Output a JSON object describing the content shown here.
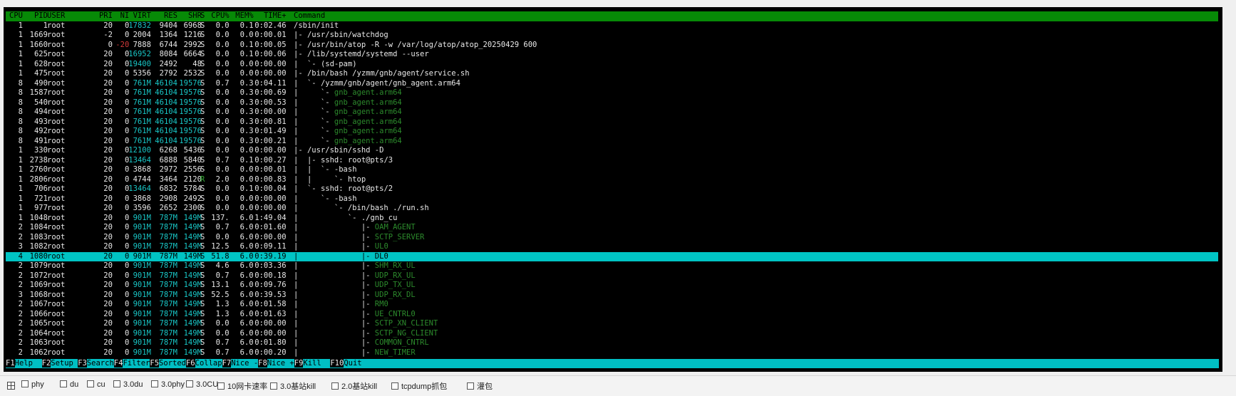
{
  "app": {
    "name": "htop"
  },
  "header": [
    "CPU",
    "PID",
    "USER",
    "PRI",
    "NI",
    "VIRT",
    "RES",
    "SHR",
    "S",
    "CPU%",
    "MEM%",
    "TIME+",
    "Command"
  ],
  "processes": [
    {
      "cpu": "1",
      "pid": "1",
      "user": "root",
      "pri": "20",
      "ni": "0",
      "virt": "17832",
      "res": "9404",
      "shr": "6968",
      "s": "S",
      "cpupct": "0.0",
      "mempct": "0.1",
      "time": "0:02.46",
      "tree": "",
      "cmd": "/sbin/init",
      "cmd_dim": false,
      "selected": false
    },
    {
      "cpu": "1",
      "pid": "1669",
      "user": "root",
      "pri": "-2",
      "ni": "0",
      "virt": "2004",
      "res": "1364",
      "shr": "1216",
      "s": "S",
      "cpupct": "0.0",
      "mempct": "0.0",
      "time": "0:00.01",
      "tree": "|- ",
      "cmd": "/usr/sbin/watchdog",
      "cmd_dim": false,
      "selected": false
    },
    {
      "cpu": "1",
      "pid": "1660",
      "user": "root",
      "pri": "0",
      "ni": "-20",
      "virt": "7888",
      "res": "6744",
      "shr": "2992",
      "s": "S",
      "cpupct": "0.0",
      "mempct": "0.1",
      "time": "0:00.05",
      "tree": "|- ",
      "cmd": "/usr/bin/atop -R -w /var/log/atop/atop_20250429 600",
      "cmd_dim": false,
      "selected": false
    },
    {
      "cpu": "1",
      "pid": "625",
      "user": "root",
      "pri": "20",
      "ni": "0",
      "virt": "16952",
      "res": "8084",
      "shr": "6664",
      "s": "S",
      "cpupct": "0.0",
      "mempct": "0.1",
      "time": "0:00.06",
      "tree": "|- ",
      "cmd": "/lib/systemd/systemd --user",
      "cmd_dim": false,
      "selected": false
    },
    {
      "cpu": "1",
      "pid": "628",
      "user": "root",
      "pri": "20",
      "ni": "0",
      "virt": "19400",
      "res": "2492",
      "shr": "48",
      "s": "S",
      "cpupct": "0.0",
      "mempct": "0.0",
      "time": "0:00.00",
      "tree": "|  `- ",
      "cmd": "(sd-pam)",
      "cmd_dim": false,
      "selected": false
    },
    {
      "cpu": "1",
      "pid": "475",
      "user": "root",
      "pri": "20",
      "ni": "0",
      "virt": "5356",
      "res": "2792",
      "shr": "2532",
      "s": "S",
      "cpupct": "0.0",
      "mempct": "0.0",
      "time": "0:00.00",
      "tree": "|- ",
      "cmd": "/bin/bash /yzmm/gnb/agent/service.sh",
      "cmd_dim": false,
      "selected": false
    },
    {
      "cpu": "8",
      "pid": "490",
      "user": "root",
      "pri": "20",
      "ni": "0",
      "virt": "761M",
      "res": "46104",
      "shr": "19576",
      "s": "S",
      "cpupct": "0.7",
      "mempct": "0.3",
      "time": "0:04.11",
      "tree": "|  `- ",
      "cmd": "/yzmm/gnb/agent/gnb_agent.arm64",
      "cmd_dim": false,
      "selected": false
    },
    {
      "cpu": "8",
      "pid": "1587",
      "user": "root",
      "pri": "20",
      "ni": "0",
      "virt": "761M",
      "res": "46104",
      "shr": "19576",
      "s": "S",
      "cpupct": "0.0",
      "mempct": "0.3",
      "time": "0:00.69",
      "tree": "|     `- ",
      "cmd": "gnb_agent.arm64",
      "cmd_dim": true,
      "selected": false
    },
    {
      "cpu": "8",
      "pid": "540",
      "user": "root",
      "pri": "20",
      "ni": "0",
      "virt": "761M",
      "res": "46104",
      "shr": "19576",
      "s": "S",
      "cpupct": "0.0",
      "mempct": "0.3",
      "time": "0:00.53",
      "tree": "|     `- ",
      "cmd": "gnb_agent.arm64",
      "cmd_dim": true,
      "selected": false
    },
    {
      "cpu": "8",
      "pid": "494",
      "user": "root",
      "pri": "20",
      "ni": "0",
      "virt": "761M",
      "res": "46104",
      "shr": "19576",
      "s": "S",
      "cpupct": "0.0",
      "mempct": "0.3",
      "time": "0:00.00",
      "tree": "|     `- ",
      "cmd": "gnb_agent.arm64",
      "cmd_dim": true,
      "selected": false
    },
    {
      "cpu": "8",
      "pid": "493",
      "user": "root",
      "pri": "20",
      "ni": "0",
      "virt": "761M",
      "res": "46104",
      "shr": "19576",
      "s": "S",
      "cpupct": "0.0",
      "mempct": "0.3",
      "time": "0:00.81",
      "tree": "|     `- ",
      "cmd": "gnb_agent.arm64",
      "cmd_dim": true,
      "selected": false
    },
    {
      "cpu": "8",
      "pid": "492",
      "user": "root",
      "pri": "20",
      "ni": "0",
      "virt": "761M",
      "res": "46104",
      "shr": "19576",
      "s": "S",
      "cpupct": "0.0",
      "mempct": "0.3",
      "time": "0:01.49",
      "tree": "|     `- ",
      "cmd": "gnb_agent.arm64",
      "cmd_dim": true,
      "selected": false
    },
    {
      "cpu": "8",
      "pid": "491",
      "user": "root",
      "pri": "20",
      "ni": "0",
      "virt": "761M",
      "res": "46104",
      "shr": "19576",
      "s": "S",
      "cpupct": "0.0",
      "mempct": "0.3",
      "time": "0:00.21",
      "tree": "|     `- ",
      "cmd": "gnb_agent.arm64",
      "cmd_dim": true,
      "selected": false
    },
    {
      "cpu": "1",
      "pid": "330",
      "user": "root",
      "pri": "20",
      "ni": "0",
      "virt": "12100",
      "res": "6268",
      "shr": "5436",
      "s": "S",
      "cpupct": "0.0",
      "mempct": "0.0",
      "time": "0:00.00",
      "tree": "|- ",
      "cmd": "/usr/sbin/sshd -D",
      "cmd_dim": false,
      "selected": false
    },
    {
      "cpu": "1",
      "pid": "2738",
      "user": "root",
      "pri": "20",
      "ni": "0",
      "virt": "13464",
      "res": "6888",
      "shr": "5840",
      "s": "S",
      "cpupct": "0.7",
      "mempct": "0.1",
      "time": "0:00.27",
      "tree": "|  |- ",
      "cmd": "sshd: root@pts/3",
      "cmd_dim": false,
      "selected": false
    },
    {
      "cpu": "1",
      "pid": "2760",
      "user": "root",
      "pri": "20",
      "ni": "0",
      "virt": "3868",
      "res": "2972",
      "shr": "2556",
      "s": "S",
      "cpupct": "0.0",
      "mempct": "0.0",
      "time": "0:00.01",
      "tree": "|  |  `- ",
      "cmd": "-bash",
      "cmd_dim": false,
      "selected": false
    },
    {
      "cpu": "1",
      "pid": "2806",
      "user": "root",
      "pri": "20",
      "ni": "0",
      "virt": "4744",
      "res": "3464",
      "shr": "2120",
      "s": "R",
      "cpupct": "2.0",
      "mempct": "0.0",
      "time": "0:00.83",
      "tree": "|  |     `- ",
      "cmd": "htop",
      "cmd_dim": false,
      "selected": false
    },
    {
      "cpu": "1",
      "pid": "706",
      "user": "root",
      "pri": "20",
      "ni": "0",
      "virt": "13464",
      "res": "6832",
      "shr": "5784",
      "s": "S",
      "cpupct": "0.0",
      "mempct": "0.1",
      "time": "0:00.04",
      "tree": "|  `- ",
      "cmd": "sshd: root@pts/2",
      "cmd_dim": false,
      "selected": false
    },
    {
      "cpu": "1",
      "pid": "721",
      "user": "root",
      "pri": "20",
      "ni": "0",
      "virt": "3868",
      "res": "2908",
      "shr": "2492",
      "s": "S",
      "cpupct": "0.0",
      "mempct": "0.0",
      "time": "0:00.00",
      "tree": "|     `- ",
      "cmd": "-bash",
      "cmd_dim": false,
      "selected": false
    },
    {
      "cpu": "1",
      "pid": "977",
      "user": "root",
      "pri": "20",
      "ni": "0",
      "virt": "3596",
      "res": "2652",
      "shr": "2300",
      "s": "S",
      "cpupct": "0.0",
      "mempct": "0.0",
      "time": "0:00.00",
      "tree": "|        `- ",
      "cmd": "/bin/bash ./run.sh",
      "cmd_dim": false,
      "selected": false
    },
    {
      "cpu": "1",
      "pid": "1048",
      "user": "root",
      "pri": "20",
      "ni": "0",
      "virt": "901M",
      "res": "787M",
      "shr": "149M",
      "s": "S",
      "cpupct": "137.",
      "mempct": "6.0",
      "time": "1:49.04",
      "tree": "|           `- ",
      "cmd": "./gnb_cu",
      "cmd_dim": false,
      "selected": false
    },
    {
      "cpu": "2",
      "pid": "1084",
      "user": "root",
      "pri": "20",
      "ni": "0",
      "virt": "901M",
      "res": "787M",
      "shr": "149M",
      "s": "S",
      "cpupct": "0.7",
      "mempct": "6.0",
      "time": "0:01.60",
      "tree": "|              |- ",
      "cmd": "OAM_AGENT",
      "cmd_dim": true,
      "selected": false
    },
    {
      "cpu": "2",
      "pid": "1083",
      "user": "root",
      "pri": "20",
      "ni": "0",
      "virt": "901M",
      "res": "787M",
      "shr": "149M",
      "s": "S",
      "cpupct": "0.0",
      "mempct": "6.0",
      "time": "0:00.00",
      "tree": "|              |- ",
      "cmd": "SCTP_SERVER",
      "cmd_dim": true,
      "selected": false
    },
    {
      "cpu": "3",
      "pid": "1082",
      "user": "root",
      "pri": "20",
      "ni": "0",
      "virt": "901M",
      "res": "787M",
      "shr": "149M",
      "s": "S",
      "cpupct": "12.5",
      "mempct": "6.0",
      "time": "0:09.11",
      "tree": "|              |- ",
      "cmd": "UL0",
      "cmd_dim": true,
      "selected": false
    },
    {
      "cpu": "4",
      "pid": "1080",
      "user": "root",
      "pri": "20",
      "ni": "0",
      "virt": "901M",
      "res": "787M",
      "shr": "149M",
      "s": "S",
      "cpupct": "51.8",
      "mempct": "6.0",
      "time": "0:39.19",
      "tree": "|              |- ",
      "cmd": "DL0",
      "cmd_dim": false,
      "selected": true
    },
    {
      "cpu": "2",
      "pid": "1079",
      "user": "root",
      "pri": "20",
      "ni": "0",
      "virt": "901M",
      "res": "787M",
      "shr": "149M",
      "s": "S",
      "cpupct": "4.6",
      "mempct": "6.0",
      "time": "0:03.36",
      "tree": "|              |- ",
      "cmd": "SHM_RX_UL",
      "cmd_dim": true,
      "selected": false
    },
    {
      "cpu": "2",
      "pid": "1072",
      "user": "root",
      "pri": "20",
      "ni": "0",
      "virt": "901M",
      "res": "787M",
      "shr": "149M",
      "s": "S",
      "cpupct": "0.7",
      "mempct": "6.0",
      "time": "0:00.18",
      "tree": "|              |- ",
      "cmd": "UDP_RX_UL",
      "cmd_dim": true,
      "selected": false
    },
    {
      "cpu": "2",
      "pid": "1069",
      "user": "root",
      "pri": "20",
      "ni": "0",
      "virt": "901M",
      "res": "787M",
      "shr": "149M",
      "s": "S",
      "cpupct": "13.1",
      "mempct": "6.0",
      "time": "0:09.76",
      "tree": "|              |- ",
      "cmd": "UDP_TX_UL",
      "cmd_dim": true,
      "selected": false
    },
    {
      "cpu": "3",
      "pid": "1068",
      "user": "root",
      "pri": "20",
      "ni": "0",
      "virt": "901M",
      "res": "787M",
      "shr": "149M",
      "s": "S",
      "cpupct": "52.5",
      "mempct": "6.0",
      "time": "0:39.53",
      "tree": "|              |- ",
      "cmd": "UDP_RX_DL",
      "cmd_dim": true,
      "selected": false
    },
    {
      "cpu": "2",
      "pid": "1067",
      "user": "root",
      "pri": "20",
      "ni": "0",
      "virt": "901M",
      "res": "787M",
      "shr": "149M",
      "s": "S",
      "cpupct": "1.3",
      "mempct": "6.0",
      "time": "0:01.58",
      "tree": "|              |- ",
      "cmd": "RM0",
      "cmd_dim": true,
      "selected": false
    },
    {
      "cpu": "2",
      "pid": "1066",
      "user": "root",
      "pri": "20",
      "ni": "0",
      "virt": "901M",
      "res": "787M",
      "shr": "149M",
      "s": "S",
      "cpupct": "1.3",
      "mempct": "6.0",
      "time": "0:01.63",
      "tree": "|              |- ",
      "cmd": "UE_CNTRL0",
      "cmd_dim": true,
      "selected": false
    },
    {
      "cpu": "2",
      "pid": "1065",
      "user": "root",
      "pri": "20",
      "ni": "0",
      "virt": "901M",
      "res": "787M",
      "shr": "149M",
      "s": "S",
      "cpupct": "0.0",
      "mempct": "6.0",
      "time": "0:00.00",
      "tree": "|              |- ",
      "cmd": "SCTP_XN_CLIENT",
      "cmd_dim": true,
      "selected": false
    },
    {
      "cpu": "2",
      "pid": "1064",
      "user": "root",
      "pri": "20",
      "ni": "0",
      "virt": "901M",
      "res": "787M",
      "shr": "149M",
      "s": "S",
      "cpupct": "0.0",
      "mempct": "6.0",
      "time": "0:00.00",
      "tree": "|              |- ",
      "cmd": "SCTP_NG_CLIENT",
      "cmd_dim": true,
      "selected": false
    },
    {
      "cpu": "2",
      "pid": "1063",
      "user": "root",
      "pri": "20",
      "ni": "0",
      "virt": "901M",
      "res": "787M",
      "shr": "149M",
      "s": "S",
      "cpupct": "0.7",
      "mempct": "6.0",
      "time": "0:01.80",
      "tree": "|              |- ",
      "cmd": "COMMON_CNTRL",
      "cmd_dim": true,
      "selected": false
    },
    {
      "cpu": "2",
      "pid": "1062",
      "user": "root",
      "pri": "20",
      "ni": "0",
      "virt": "901M",
      "res": "787M",
      "shr": "149M",
      "s": "S",
      "cpupct": "0.7",
      "mempct": "6.0",
      "time": "0:00.20",
      "tree": "|              |- ",
      "cmd": "NEW_TIMER",
      "cmd_dim": true,
      "selected": false
    }
  ],
  "fkeys": [
    {
      "key": "F1",
      "label": "Help  "
    },
    {
      "key": "F2",
      "label": "Setup "
    },
    {
      "key": "F3",
      "label": "Search"
    },
    {
      "key": "F4",
      "label": "Filter"
    },
    {
      "key": "F5",
      "label": "Sorted"
    },
    {
      "key": "F6",
      "label": "Collap"
    },
    {
      "key": "F7",
      "label": "Nice -"
    },
    {
      "key": "F8",
      "label": "Nice +"
    },
    {
      "key": "F9",
      "label": "Kill  "
    },
    {
      "key": "F10",
      "label": "Quit  "
    }
  ],
  "tabs": [
    {
      "label": "phy"
    },
    {
      "label": "du"
    },
    {
      "label": "cu"
    },
    {
      "label": "3.0du"
    },
    {
      "label": "3.0phy"
    },
    {
      "label": "3.0CU"
    },
    {
      "label": "10网卡速率"
    },
    {
      "label": "3.0基站kill"
    },
    {
      "label": "2.0基站kill"
    },
    {
      "label": "tcpdump抓包"
    },
    {
      "label": "灌包"
    }
  ],
  "colors": {
    "header_bg": "#078a07",
    "selection_bg": "#00c4c4",
    "function_bar_bg": "#00bfc4",
    "terminal_bg": "#000000",
    "large_value": "#19c6c6",
    "negative_nice": "#d23a3a",
    "thread_name": "#2c8a2c"
  }
}
